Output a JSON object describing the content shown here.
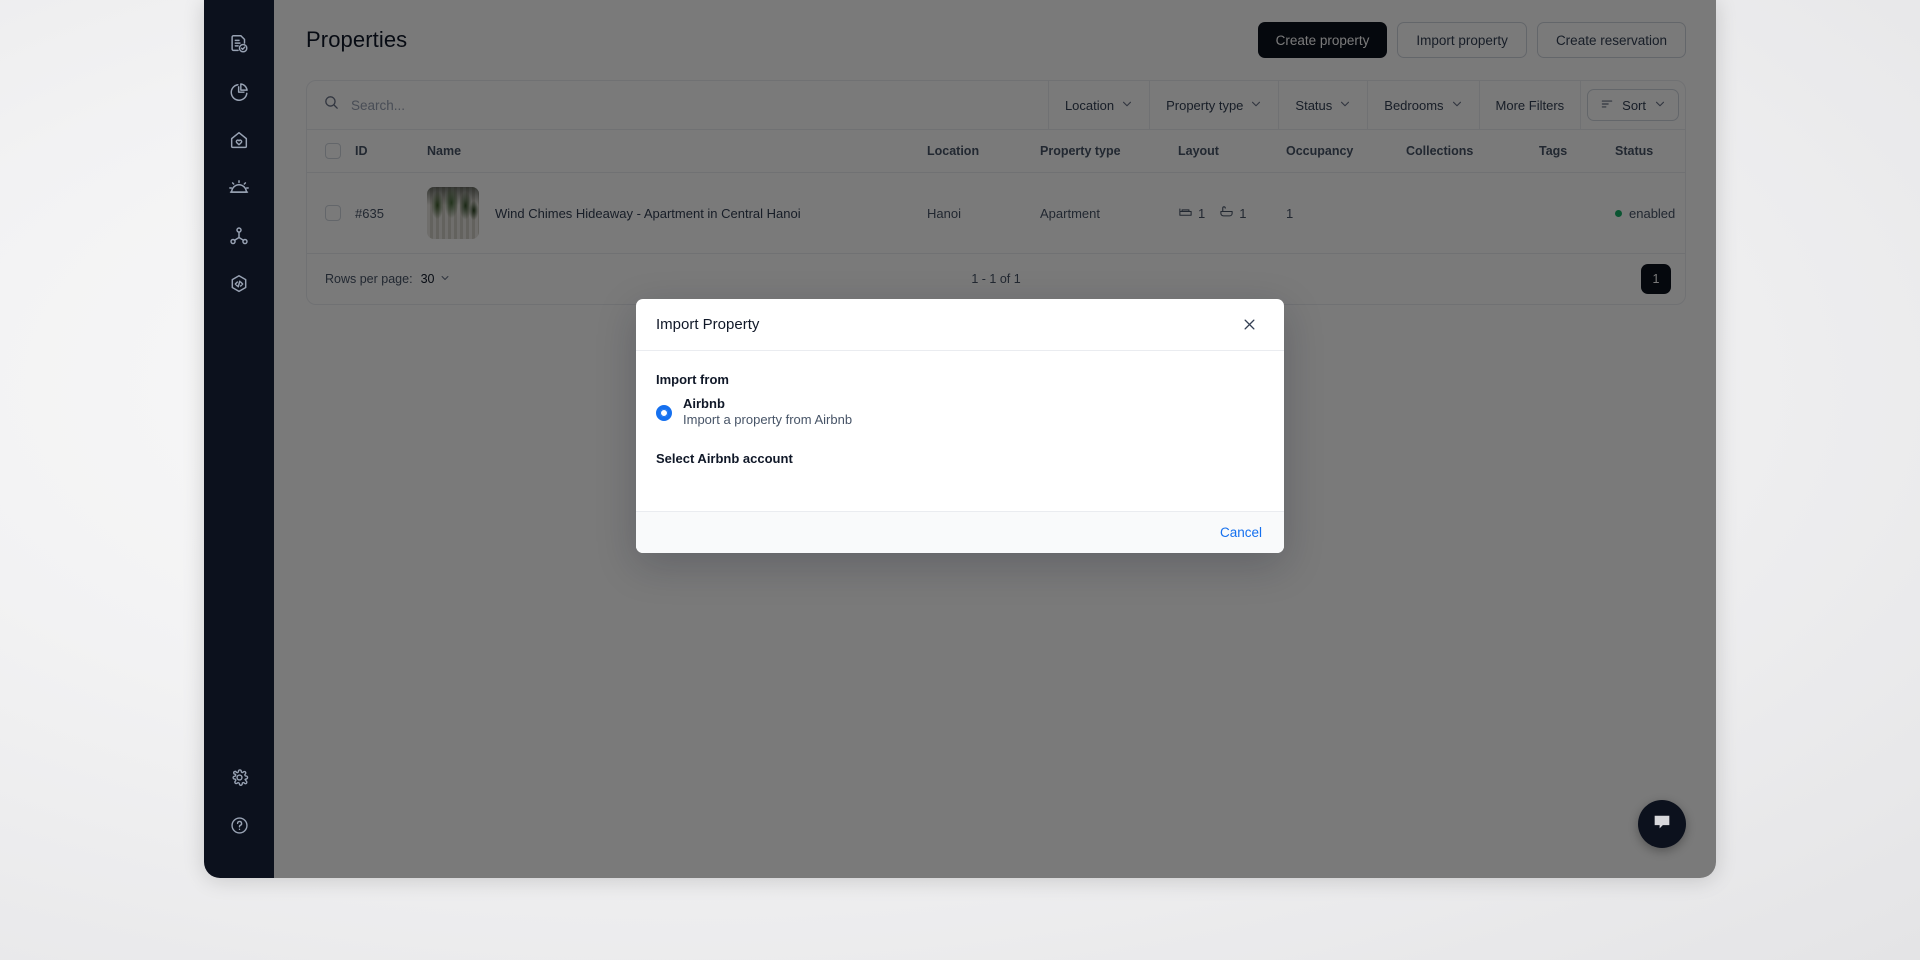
{
  "app": {
    "page_title": "Properties"
  },
  "sidebar": {
    "top_items": [
      {
        "icon": "document-check-icon",
        "name": "sidebar-item-bookings"
      },
      {
        "icon": "pie-chart-icon",
        "name": "sidebar-item-analytics"
      },
      {
        "icon": "home-heart-icon",
        "name": "sidebar-item-properties"
      },
      {
        "icon": "service-bell-icon",
        "name": "sidebar-item-services"
      },
      {
        "icon": "network-nodes-icon",
        "name": "sidebar-item-integrations"
      },
      {
        "icon": "hexagon-code-icon",
        "name": "sidebar-item-developers"
      }
    ],
    "bottom_items": [
      {
        "icon": "gear-icon",
        "name": "sidebar-item-settings"
      },
      {
        "icon": "question-circle-icon",
        "name": "sidebar-item-help"
      }
    ]
  },
  "header": {
    "buttons": [
      {
        "label": "Create property",
        "style": "primary"
      },
      {
        "label": "Import property",
        "style": "secondary"
      },
      {
        "label": "Create reservation",
        "style": "secondary"
      }
    ]
  },
  "toolbar": {
    "search_placeholder": "Search...",
    "search_value": "",
    "search_icon": "search-icon",
    "filters": [
      {
        "label": "Location",
        "icon": "chevron-down-icon"
      },
      {
        "label": "Property type",
        "icon": "chevron-down-icon"
      },
      {
        "label": "Status",
        "icon": "chevron-down-icon"
      },
      {
        "label": "Bedrooms",
        "icon": "chevron-down-icon"
      },
      {
        "label": "More Filters",
        "icon": ""
      }
    ],
    "sort": {
      "label": "Sort",
      "icon": "sort-lines-icon",
      "chevron": "chevron-down-icon"
    }
  },
  "table": {
    "columns": [
      "ID",
      "Name",
      "Location",
      "Property type",
      "Layout",
      "Occupancy",
      "Collections",
      "Tags",
      "Status"
    ],
    "rows": [
      {
        "id": "#635",
        "name": "Wind Chimes Hideaway - Apartment in Central Hanoi",
        "location": "Hanoi",
        "property_type": "Apartment",
        "bedrooms": "1",
        "bathrooms": "1",
        "occupancy": "1",
        "collections": "",
        "tags": "",
        "status": "enabled",
        "status_color": "#17b26a",
        "thumbnail_alt": "potted-plants-photo"
      }
    ]
  },
  "pagination": {
    "rows_per_page_label": "Rows per page:",
    "rows_per_page_value": "30",
    "range_text": "1 - 1 of 1",
    "pages": [
      "1"
    ],
    "current_page": "1"
  },
  "chat": {
    "icon": "chat-bubble-icon"
  },
  "modal": {
    "title": "Import Property",
    "close_icon": "close-icon",
    "import_from_label": "Import from",
    "options": [
      {
        "title": "Airbnb",
        "description": "Import a property from Airbnb",
        "selected": true
      }
    ],
    "account_label": "Select Airbnb account",
    "cancel_label": "Cancel",
    "accent_color": "#1570ef"
  }
}
